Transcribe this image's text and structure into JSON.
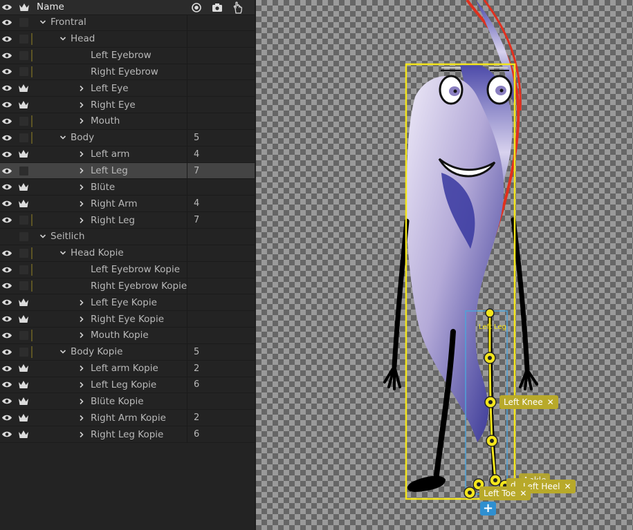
{
  "header": {
    "name_label": "Name"
  },
  "layers": [
    {
      "label": "Frontral",
      "indent": 0,
      "chevron": "down",
      "count": "",
      "visible": true,
      "crown": false,
      "mark": false,
      "selected": false
    },
    {
      "label": "Head",
      "indent": 1,
      "chevron": "down",
      "count": "",
      "visible": true,
      "crown": false,
      "mark": true,
      "selected": false
    },
    {
      "label": "Left Eyebrow",
      "indent": 2,
      "chevron": "none",
      "count": "",
      "visible": true,
      "crown": false,
      "mark": true,
      "selected": false
    },
    {
      "label": "Right Eyebrow",
      "indent": 2,
      "chevron": "none",
      "count": "",
      "visible": true,
      "crown": false,
      "mark": true,
      "selected": false
    },
    {
      "label": "Left Eye",
      "indent": 2,
      "chevron": "right",
      "count": "",
      "visible": true,
      "crown": true,
      "mark": false,
      "selected": false
    },
    {
      "label": "Right Eye",
      "indent": 2,
      "chevron": "right",
      "count": "",
      "visible": true,
      "crown": true,
      "mark": false,
      "selected": false
    },
    {
      "label": "Mouth",
      "indent": 2,
      "chevron": "right",
      "count": "",
      "visible": true,
      "crown": false,
      "mark": true,
      "selected": false
    },
    {
      "label": "Body",
      "indent": 1,
      "chevron": "down",
      "count": "5",
      "visible": true,
      "crown": false,
      "mark": true,
      "selected": false
    },
    {
      "label": "Left arm",
      "indent": 2,
      "chevron": "right",
      "count": "4",
      "visible": true,
      "crown": true,
      "mark": false,
      "selected": false
    },
    {
      "label": "Left Leg",
      "indent": 2,
      "chevron": "right",
      "count": "7",
      "visible": true,
      "crown": false,
      "mark": false,
      "selected": true
    },
    {
      "label": "Blüte",
      "indent": 2,
      "chevron": "right",
      "count": "",
      "visible": true,
      "crown": true,
      "mark": false,
      "selected": false
    },
    {
      "label": "Right Arm",
      "indent": 2,
      "chevron": "right",
      "count": "4",
      "visible": true,
      "crown": true,
      "mark": false,
      "selected": false
    },
    {
      "label": "Right Leg",
      "indent": 2,
      "chevron": "right",
      "count": "7",
      "visible": true,
      "crown": false,
      "mark": true,
      "selected": false
    },
    {
      "label": "Seitlich",
      "indent": 0,
      "chevron": "down",
      "count": "",
      "visible": false,
      "crown": false,
      "mark": false,
      "selected": false
    },
    {
      "label": "Head Kopie",
      "indent": 1,
      "chevron": "down",
      "count": "",
      "visible": true,
      "crown": false,
      "mark": true,
      "selected": false
    },
    {
      "label": "Left Eyebrow Kopie",
      "indent": 2,
      "chevron": "none",
      "count": "",
      "visible": true,
      "crown": false,
      "mark": true,
      "selected": false
    },
    {
      "label": "Right Eyebrow Kopie",
      "indent": 2,
      "chevron": "none",
      "count": "",
      "visible": true,
      "crown": false,
      "mark": true,
      "selected": false
    },
    {
      "label": "Left Eye Kopie",
      "indent": 2,
      "chevron": "right",
      "count": "",
      "visible": true,
      "crown": true,
      "mark": false,
      "selected": false
    },
    {
      "label": "Right Eye Kopie",
      "indent": 2,
      "chevron": "right",
      "count": "",
      "visible": true,
      "crown": true,
      "mark": false,
      "selected": false
    },
    {
      "label": "Mouth Kopie",
      "indent": 2,
      "chevron": "right",
      "count": "",
      "visible": true,
      "crown": false,
      "mark": true,
      "selected": false
    },
    {
      "label": "Body Kopie",
      "indent": 1,
      "chevron": "down",
      "count": "5",
      "visible": true,
      "crown": false,
      "mark": true,
      "selected": false
    },
    {
      "label": "Left arm Kopie",
      "indent": 2,
      "chevron": "right",
      "count": "2",
      "visible": true,
      "crown": true,
      "mark": false,
      "selected": false
    },
    {
      "label": "Left Leg Kopie",
      "indent": 2,
      "chevron": "right",
      "count": "6",
      "visible": true,
      "crown": true,
      "mark": false,
      "selected": false
    },
    {
      "label": "Blüte Kopie",
      "indent": 2,
      "chevron": "right",
      "count": "",
      "visible": true,
      "crown": true,
      "mark": false,
      "selected": false
    },
    {
      "label": "Right Arm Kopie",
      "indent": 2,
      "chevron": "right",
      "count": "2",
      "visible": true,
      "crown": true,
      "mark": false,
      "selected": false
    },
    {
      "label": "Right Leg Kopie",
      "indent": 2,
      "chevron": "right",
      "count": "6",
      "visible": true,
      "crown": true,
      "mark": false,
      "selected": false
    }
  ],
  "canvas": {
    "selected_layer_label": "Left Leg",
    "handle_labels": {
      "left_knee": "Left Knee",
      "ankle": "Ankle",
      "heel": "Left Heel",
      "toe": "Left Toe",
      "left_fragment": "d"
    },
    "add_label": "+"
  },
  "colors": {
    "selection_box": "#f3e51c",
    "bone_box": "#4da3d9",
    "handle": "#f3e51c",
    "tag_bg": "#b8a92a",
    "add_button": "#2f8fd0",
    "character_outline_red": "#e0301e"
  }
}
